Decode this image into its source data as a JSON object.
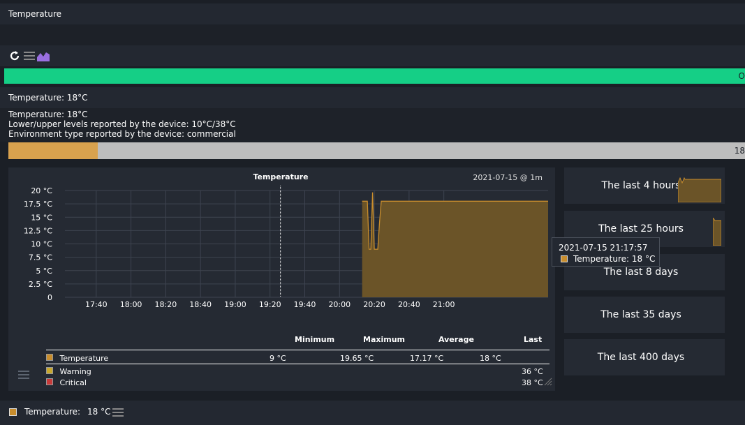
{
  "title": "Temperature",
  "state_label": "O",
  "summary": "Temperature: 18°C",
  "details": [
    "Temperature: 18°C",
    "Lower/upper levels reported by the device: 10°C/38°C",
    "Environment type reported by the device: commercial"
  ],
  "perf": {
    "value_label": "18",
    "fill_fraction": 0.121
  },
  "graph": {
    "title": "Temperature",
    "date": "2021-07-15 @ 1m",
    "table_headers": [
      "Minimum",
      "Maximum",
      "Average",
      "Last"
    ],
    "rows": [
      {
        "name": "Temperature",
        "min": "9 °C",
        "max": "19.65 °C",
        "avg": "17.17 °C",
        "last": "18 °C",
        "color": "#c88d2d"
      },
      {
        "name": "Warning",
        "last": "36 °C",
        "color": "#c8a82d"
      },
      {
        "name": "Critical",
        "last": "38 °C",
        "color": "#c83a3a"
      }
    ]
  },
  "chart_data": {
    "type": "area",
    "title": "Temperature",
    "y_ticks": [
      "20 °C",
      "17.5 °C",
      "15 °C",
      "12.5 °C",
      "10 °C",
      "7.5 °C",
      "5 °C",
      "2.5 °C",
      "0"
    ],
    "x_ticks": [
      "17:40",
      "18:00",
      "18:20",
      "18:40",
      "19:00",
      "19:20",
      "19:40",
      "20:00",
      "20:20",
      "20:40",
      "21:00"
    ],
    "ylim": [
      0,
      20
    ],
    "xlim": [
      "17:22",
      "22:00"
    ],
    "series": [
      {
        "name": "Temperature",
        "color": "#c88d2d",
        "x": [
          "20:13",
          "20:16",
          "20:17",
          "20:18",
          "20:19",
          "20:20",
          "20:21",
          "20:22",
          "20:23",
          "20:24",
          "20:25",
          "22:00"
        ],
        "y": [
          18,
          18,
          9,
          9,
          19.65,
          9,
          9,
          9,
          14,
          18,
          18,
          18
        ]
      }
    ],
    "grid": true,
    "cursor_time": "19:26"
  },
  "periods": [
    "The last 4 hours",
    "The last 25 hours",
    "The last 8 days",
    "The last 35 days",
    "The last 400 days"
  ],
  "tooltip": {
    "time": "2021-07-15 21:17:57",
    "text": "Temperature: 18 °C"
  },
  "footer": {
    "label": "Temperature:",
    "value": "18 °C"
  }
}
